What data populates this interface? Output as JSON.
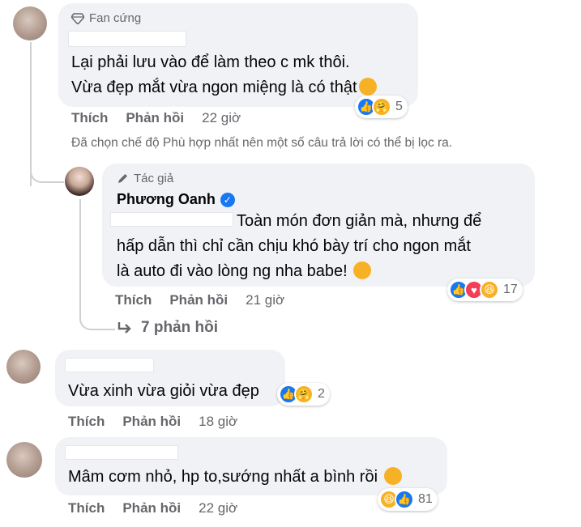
{
  "comments": [
    {
      "badge": "Fan cứng",
      "lines": [
        "Lại phải lưu vào để làm theo c mk thôi.",
        "Vừa đẹp mắt vừa ngon miệng là có thật"
      ],
      "actions": {
        "like": "Thích",
        "reply": "Phản hồi",
        "time": "22 giờ"
      },
      "reaction_count": "5",
      "reactions": [
        "like-icon",
        "care-icon"
      ]
    },
    {
      "lines": [
        "Vừa xinh vừa giỏi vừa đẹp"
      ],
      "actions": {
        "like": "Thích",
        "reply": "Phản hồi",
        "time": "18 giờ"
      },
      "reaction_count": "2",
      "reactions": [
        "like-icon",
        "care-icon"
      ]
    },
    {
      "lines": [
        "Mâm cơm nhỏ, hp to,sướng nhất a bình rồi"
      ],
      "actions": {
        "like": "Thích",
        "reply": "Phản hồi",
        "time": "22 giờ"
      },
      "reaction_count": "81",
      "reactions": [
        "haha-icon",
        "like-icon"
      ]
    }
  ],
  "filter_note": "Đã chọn chế độ Phù hợp nhất nên một số câu trả lời có thể bị lọc ra.",
  "author_reply": {
    "badge": "Tác giả",
    "name": "Phương Oanh",
    "lines": [
      "Toàn món đơn giản mà, nhưng để",
      "hấp dẫn thì chỉ cần chịu khó bày trí cho ngon mắt",
      "là auto đi vào lòng ng nha babe!"
    ],
    "actions": {
      "like": "Thích",
      "reply": "Phản hồi",
      "time": "21 giờ"
    },
    "reaction_count": "17",
    "reactions": [
      "like-icon",
      "love-icon",
      "haha-icon"
    ]
  },
  "more_replies": "7 phản hồi",
  "colors": {
    "accent": "#1877f2",
    "bubble": "#f0f2f5",
    "muted": "#65676b"
  }
}
